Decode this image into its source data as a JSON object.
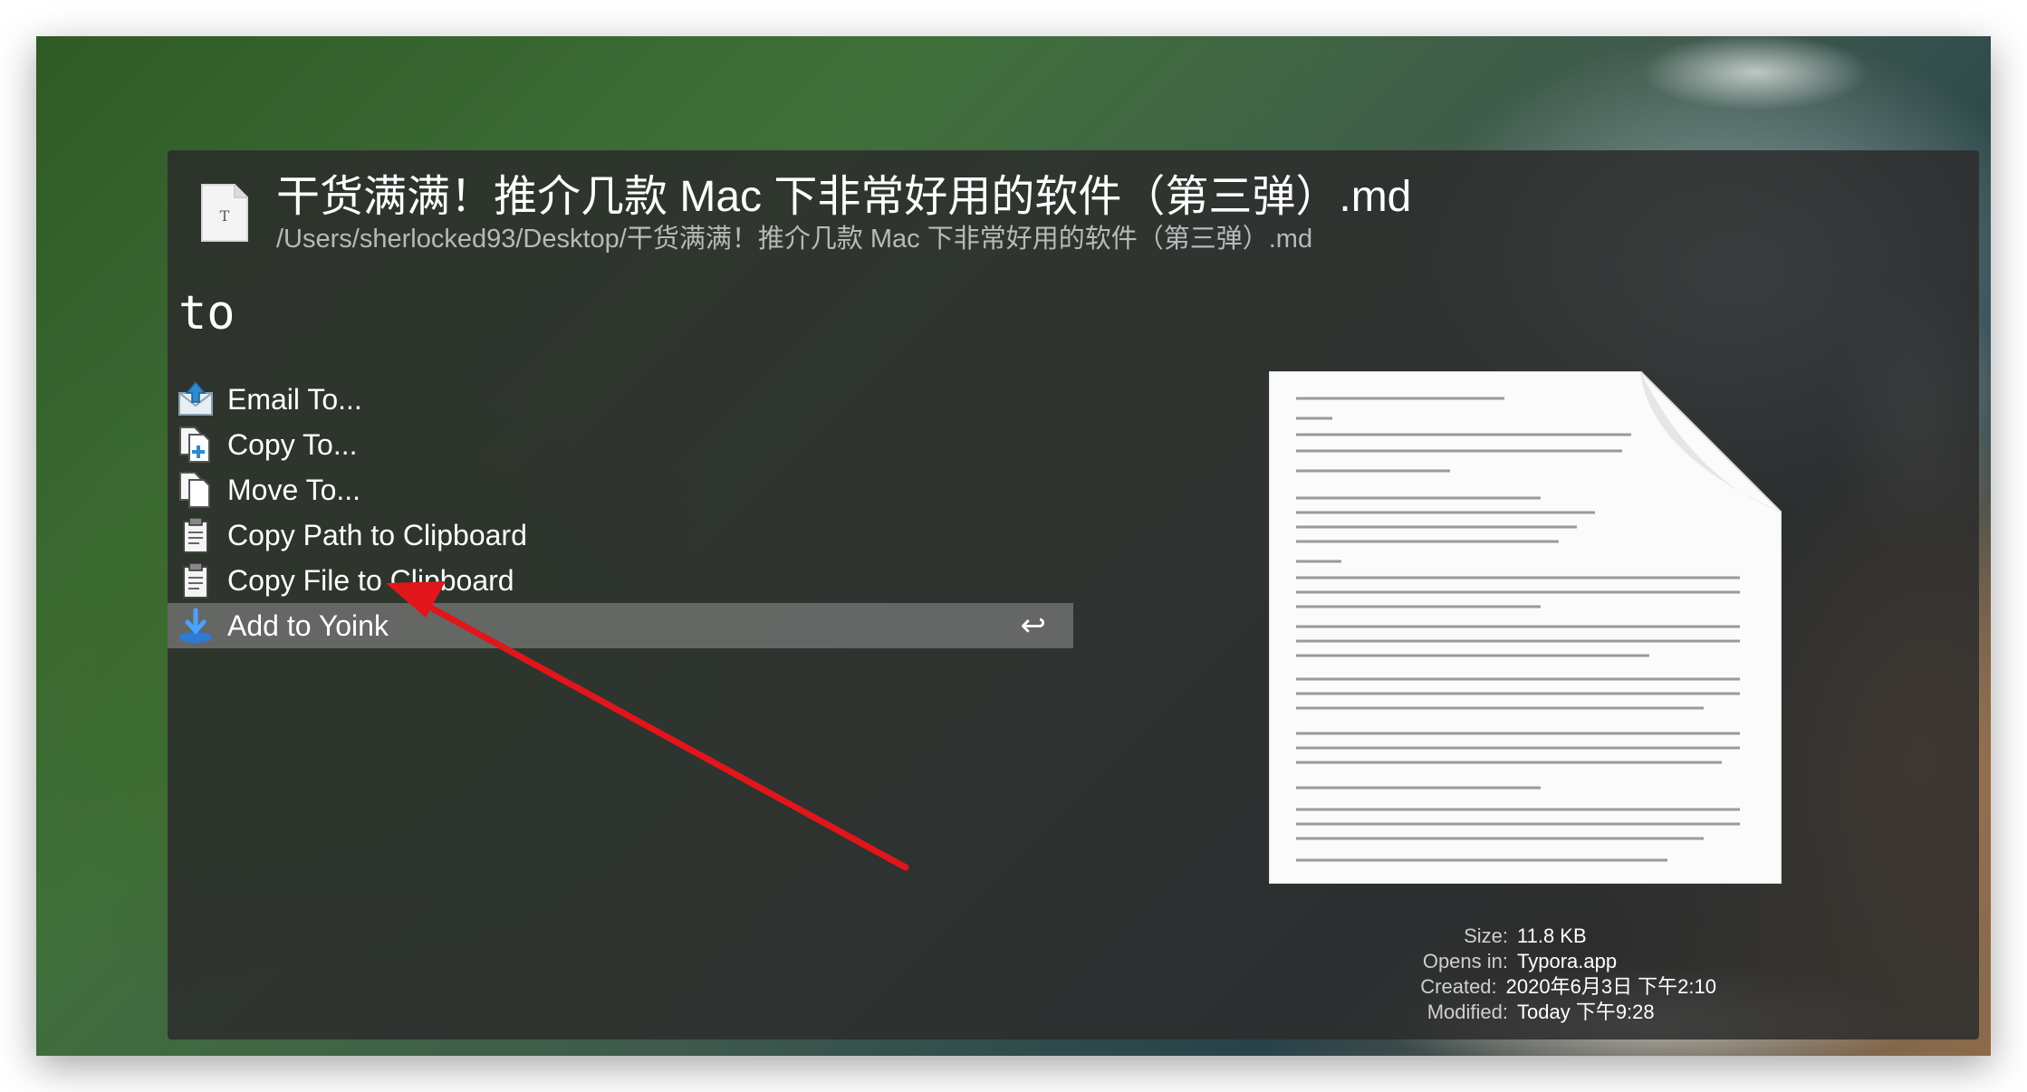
{
  "header": {
    "title": "干货满满！推介几款 Mac 下非常好用的软件（第三弹）.md",
    "path": "/Users/sherlocked93/Desktop/干货满满！推介几款 Mac 下非常好用的软件（第三弹）.md",
    "file_icon": "document-icon",
    "file_icon_letter": "T"
  },
  "search": {
    "query": "to"
  },
  "actions": [
    {
      "label": "Email To...",
      "icon": "email-icon"
    },
    {
      "label": "Copy To...",
      "icon": "copy-to-icon"
    },
    {
      "label": "Move To...",
      "icon": "move-to-icon"
    },
    {
      "label": "Copy Path to Clipboard",
      "icon": "clipboard-icon"
    },
    {
      "label": "Copy File to Clipboard",
      "icon": "clipboard-icon"
    },
    {
      "label": "Add to Yoink",
      "icon": "yoink-icon",
      "selected": true,
      "shortcut": "↩"
    }
  ],
  "file_info": {
    "size_label": "Size:",
    "size": "11.8 KB",
    "opens_in_label": "Opens in:",
    "opens_in": "Typora.app",
    "created_label": "Created:",
    "created": "2020年6月3日 下午2:10",
    "modified_label": "Modified:",
    "modified": "Today 下午9:28"
  },
  "colors": {
    "panel": "#2c2c2c",
    "selected_row": "#787878",
    "arrow": "#e0161b",
    "yoink_blue": "#2e7bd6"
  }
}
